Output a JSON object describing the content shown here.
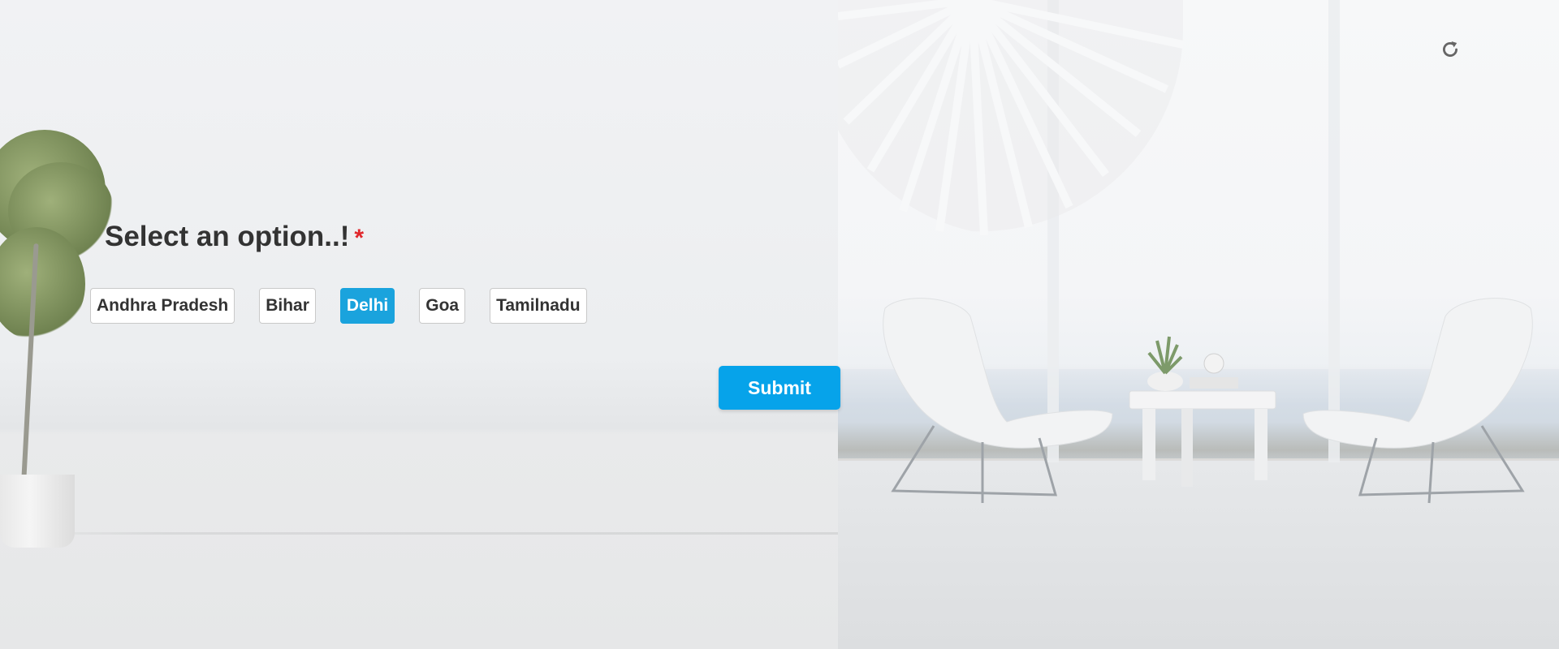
{
  "form": {
    "title": "Select an option..!",
    "required_marker": "*",
    "options": [
      {
        "label": "Andhra Pradesh",
        "selected": false
      },
      {
        "label": "Bihar",
        "selected": false
      },
      {
        "label": "Delhi",
        "selected": true
      },
      {
        "label": "Goa",
        "selected": false
      },
      {
        "label": "Tamilnadu",
        "selected": false
      }
    ],
    "submit_label": "Submit"
  },
  "icons": {
    "refresh": "refresh-icon"
  },
  "colors": {
    "accent": "#06a3ea",
    "selected_option": "#1aa3dd",
    "required": "#e0262b",
    "text": "#333333"
  }
}
